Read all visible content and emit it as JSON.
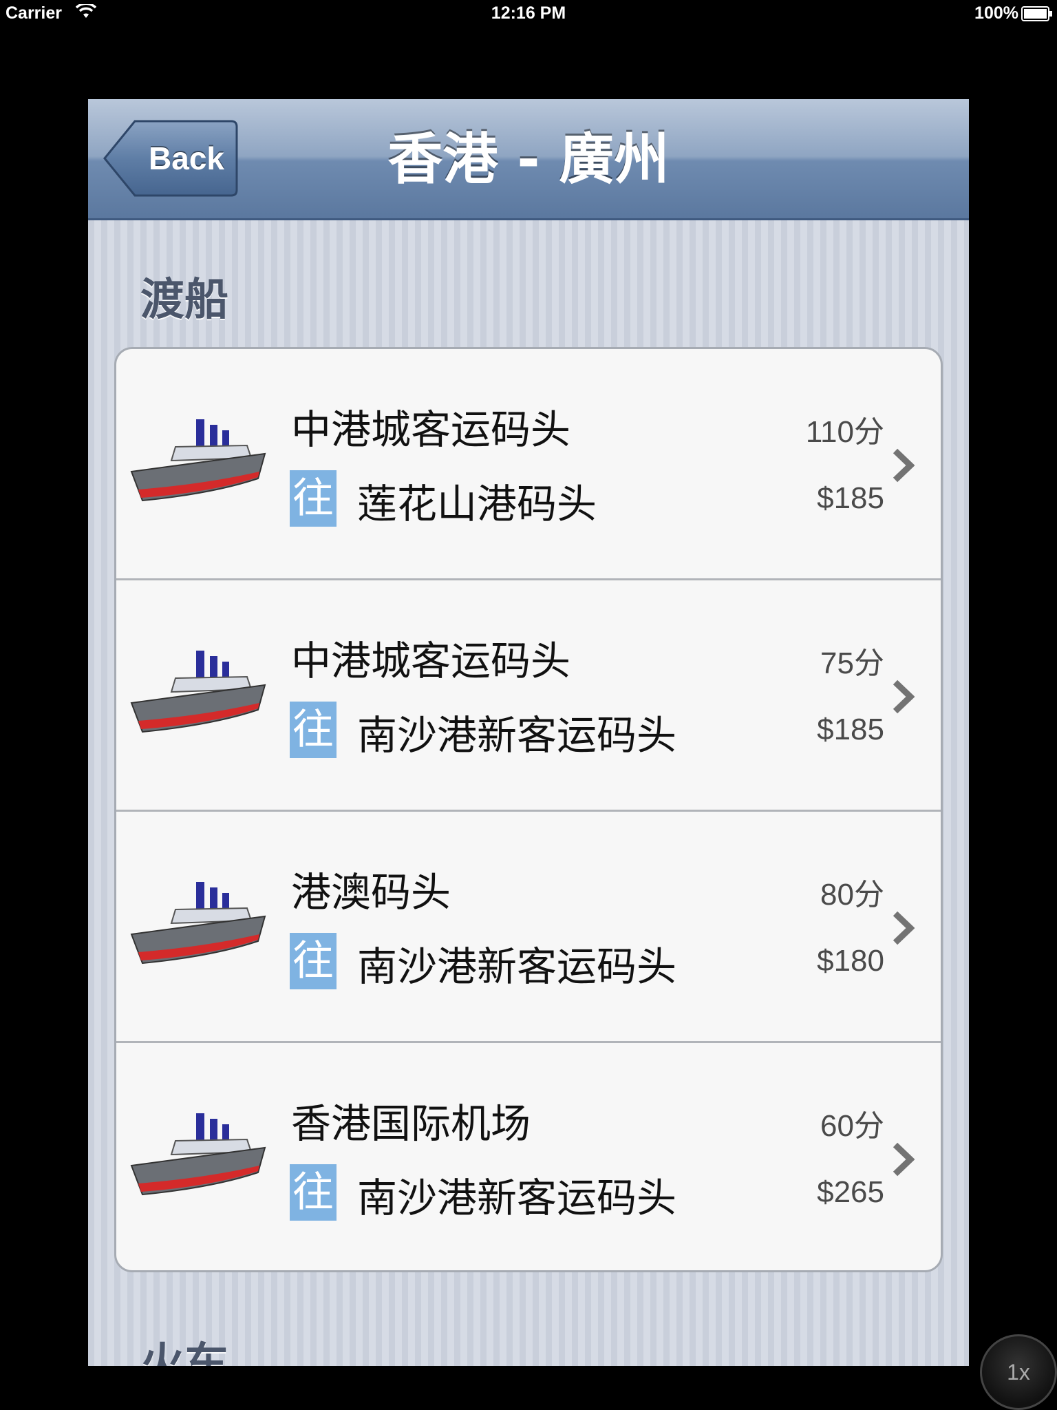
{
  "status_bar": {
    "carrier": "Carrier",
    "time": "12:16 PM",
    "battery": "100%"
  },
  "navbar": {
    "back_label": "Back",
    "title": "香港 - 廣州"
  },
  "sections": [
    {
      "title": "渡船",
      "rows": [
        {
          "from": "中港城客运码头",
          "badge": "往",
          "to": "莲花山港码头",
          "duration": "110分",
          "price": "$185",
          "icon": "ship-icon"
        },
        {
          "from": "中港城客运码头",
          "badge": "往",
          "to": "南沙港新客运码头",
          "duration": "75分",
          "price": "$185",
          "icon": "ship-icon"
        },
        {
          "from": "港澳码头",
          "badge": "往",
          "to": "南沙港新客运码头",
          "duration": "80分",
          "price": "$180",
          "icon": "ship-icon"
        },
        {
          "from": "香港国际机场",
          "badge": "往",
          "to": "南沙港新客运码头",
          "duration": "60分",
          "price": "$265",
          "icon": "ship-icon"
        }
      ]
    },
    {
      "title": "火车"
    }
  ],
  "zoom": "1x",
  "colors": {
    "navbar": "#6f8bb0",
    "badge": "#7fb3e2",
    "background": "#cfd5e0"
  }
}
